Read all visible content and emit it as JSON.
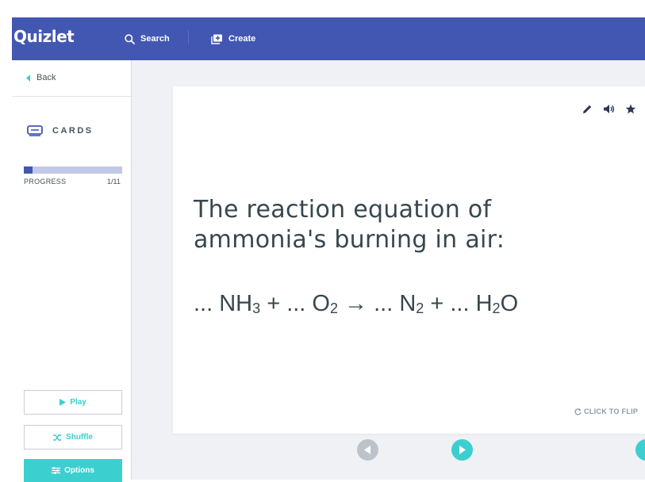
{
  "header": {
    "logo": "Quizlet",
    "search_label": "Search",
    "create_label": "Create"
  },
  "sidebar": {
    "back_label": "Back",
    "mode_label": "CARDS",
    "progress_label": "PROGRESS",
    "progress_count": "1/11",
    "progress_fraction": 0.0909,
    "play_label": "Play",
    "shuffle_label": "Shuffle",
    "options_label": "Options"
  },
  "card": {
    "term_line1": "The reaction equation of",
    "term_line2": "ammonia's burning in air:",
    "equation": {
      "p1": "... NH",
      "s1": "3",
      "p2": " + ... O",
      "s2": "2",
      "p3": " → ... N",
      "s3": "2",
      "p4": " + ... H",
      "s4": "2",
      "p5": "O"
    },
    "flip_label": "CLICK TO FLIP"
  },
  "colors": {
    "brand": "#4257b2",
    "accent": "#3ccfcf",
    "text": "#37474f"
  },
  "icons": [
    "search-icon",
    "create-icon",
    "back-chevron-icon",
    "cards-icon",
    "edit-icon",
    "audio-icon",
    "star-icon",
    "refresh-icon",
    "play-icon",
    "shuffle-icon",
    "options-icon",
    "prev-arrow-icon",
    "next-arrow-icon"
  ]
}
